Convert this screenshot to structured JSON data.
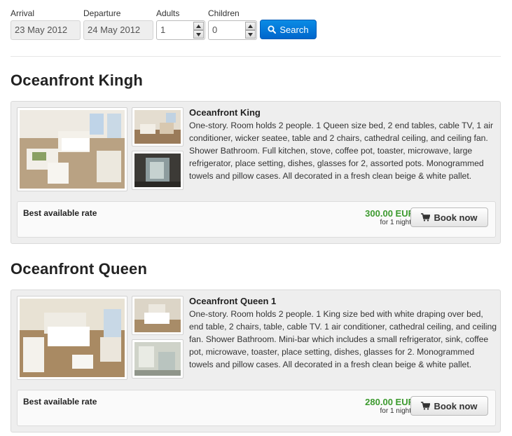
{
  "search": {
    "arrival_label": "Arrival",
    "arrival_value": "23 May 2012",
    "departure_label": "Departure",
    "departure_value": "24 May 2012",
    "adults_label": "Adults",
    "adults_value": "1",
    "children_label": "Children",
    "children_value": "0",
    "search_button": "Search",
    "search_icon": "search-icon"
  },
  "rooms": [
    {
      "title": "Oceanfront Kingh",
      "name": "Oceanfront King",
      "description": "One-story. Room holds 2 people. 1 Queen size bed, 2 end tables, cable TV, 1 air conditioner, wicker seatee, table and 2 chairs, cathedral ceiling, and ceiling fan. Shower Bathroom. Full kitchen, stove, coffee pot, toaster, microwave, large refrigerator, place setting, dishes, glasses for 2, assorted pots. Monogrammed towels and pillow cases. All decorated in a fresh clean beige & white pallet.",
      "rate_label": "Best available rate",
      "price": "300.00 EUR",
      "price_note": "for 1 nights",
      "book_button": "Book now",
      "cart_icon": "cart-icon"
    },
    {
      "title": "Oceanfront Queen",
      "name": "Oceanfront Queen 1",
      "description": "One-story. Room holds 2 people. 1 King size bed with white draping over bed, end table, 2 chairs, table, cable TV. 1 air conditioner, cathedral ceiling, and ceiling fan. Shower Bathroom. Mini-bar which includes a small refrigerator, sink, coffee pot, microwave, toaster, place setting, dishes, glasses for 2. Monogrammed towels and pillow cases. All decorated in a fresh clean beige & white pallet.",
      "rate_label": "Best available rate",
      "price": "280.00 EUR",
      "price_note": "for 1 nights",
      "book_button": "Book now",
      "cart_icon": "cart-icon"
    }
  ],
  "colors": {
    "accent_blue": "#0a7fd8",
    "price_green": "#3c9a2e",
    "card_bg": "#eeeeee"
  }
}
